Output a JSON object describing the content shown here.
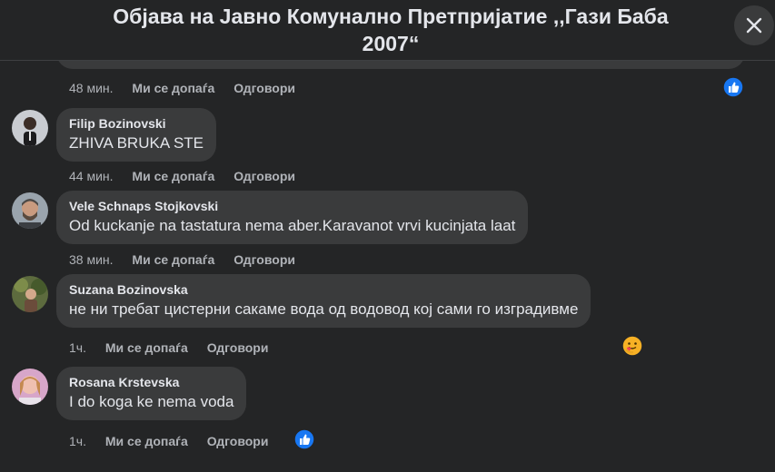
{
  "header": {
    "title_line1": "Објава на Јавно Комунално Претпријатие ,,Гази Баба",
    "title_line2": "2007“"
  },
  "colors": {
    "background": "#242526",
    "bubble": "#3a3b3c",
    "like_blue": "#1877f2",
    "muted_text": "#b0b3b8"
  },
  "comments": [
    {
      "time": "48 мин.",
      "like_label": "Ми се допаѓа",
      "reply_label": "Одговори",
      "reaction": "like-icon"
    },
    {
      "author": "Filip Bozinovski",
      "text": "ZHIVA BRUKA STE",
      "time": "44 мин.",
      "like_label": "Ми се допаѓа",
      "reply_label": "Одговори"
    },
    {
      "author": "Vele Schnaps Stojkovski",
      "text": "Od kuckanje na tastatura nema aber.Karavanot vrvi kucinjata laat",
      "time": "38 мин.",
      "like_label": "Ми се допаѓа",
      "reply_label": "Одговори"
    },
    {
      "author": "Suzana Bozinovska",
      "text": "не ни требат цистерни сакаме вода од водовод кој сами го изградивме",
      "time": "1ч.",
      "like_label": "Ми се допаѓа",
      "reply_label": "Одговори",
      "reaction": "care-icon"
    },
    {
      "author": "Rosana Krstevska",
      "text": "I do koga ke nema voda",
      "time": "1ч.",
      "like_label": "Ми се допаѓа",
      "reply_label": "Одговори",
      "reaction": "like-icon"
    }
  ]
}
